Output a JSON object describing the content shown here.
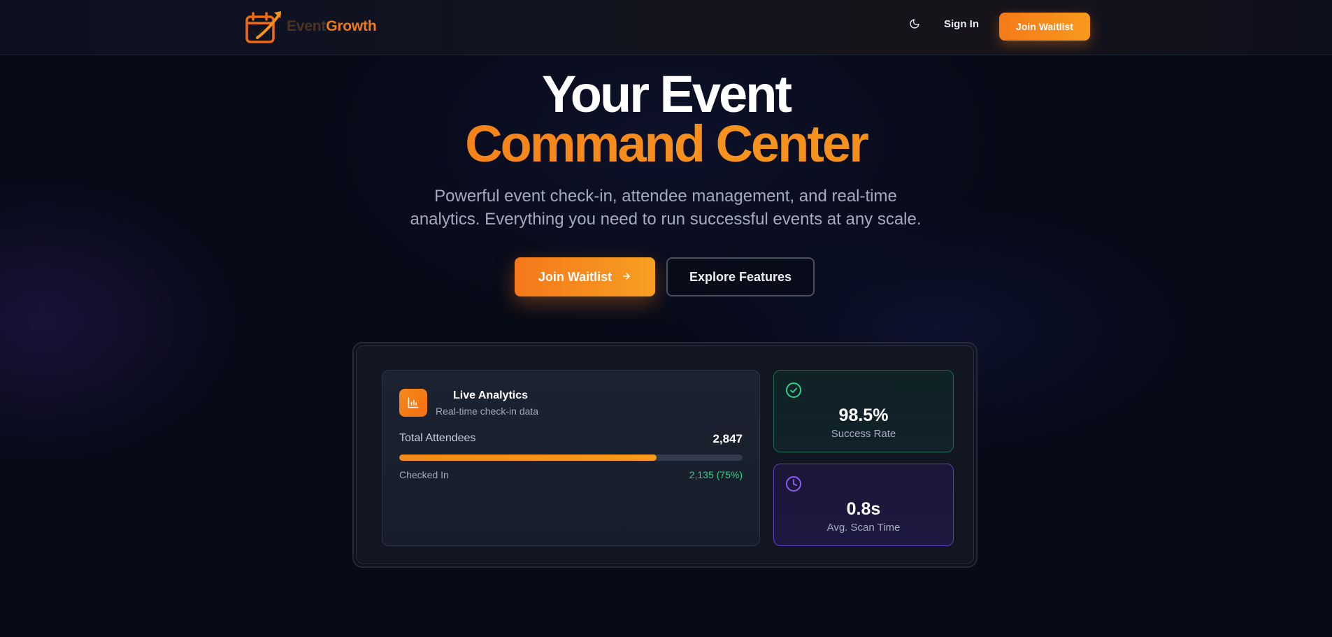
{
  "header": {
    "logo": {
      "word1": "Event",
      "word2": "Growth"
    },
    "theme_icon": "moon-icon",
    "sign_in_label": "Sign In",
    "cta_label": "Join Waitlist"
  },
  "hero": {
    "title_line1": "Your Event",
    "title_line2": "Command Center",
    "subtitle_line1": "Powerful event check-in, attendee management, and real-time",
    "subtitle_line2": "analytics. Everything you need to run successful events at any scale.",
    "primary_button": {
      "label": "Join Waitlist",
      "icon": "arrow-right-icon"
    },
    "secondary_button": {
      "label": "Explore Features"
    }
  },
  "dashboard": {
    "analytics": {
      "icon": "bar-chart-icon",
      "title": "Live Analytics",
      "subtitle": "Real-time check-in data",
      "total_label": "Total Attendees",
      "total_value": "2,847",
      "progress_fraction": 0.75,
      "checked_label": "Checked In",
      "checked_value": "2,135 (75%)"
    },
    "stats": [
      {
        "icon": "check-circle-icon",
        "value": "98.5%",
        "label": "Success Rate"
      },
      {
        "icon": "clock-icon",
        "value": "0.8s",
        "label": "Avg. Scan Time"
      }
    ]
  },
  "colors": {
    "accent": "#f58a1a",
    "background": "#070a17",
    "success": "#2fd08a",
    "purple": "#8b5cf6"
  }
}
